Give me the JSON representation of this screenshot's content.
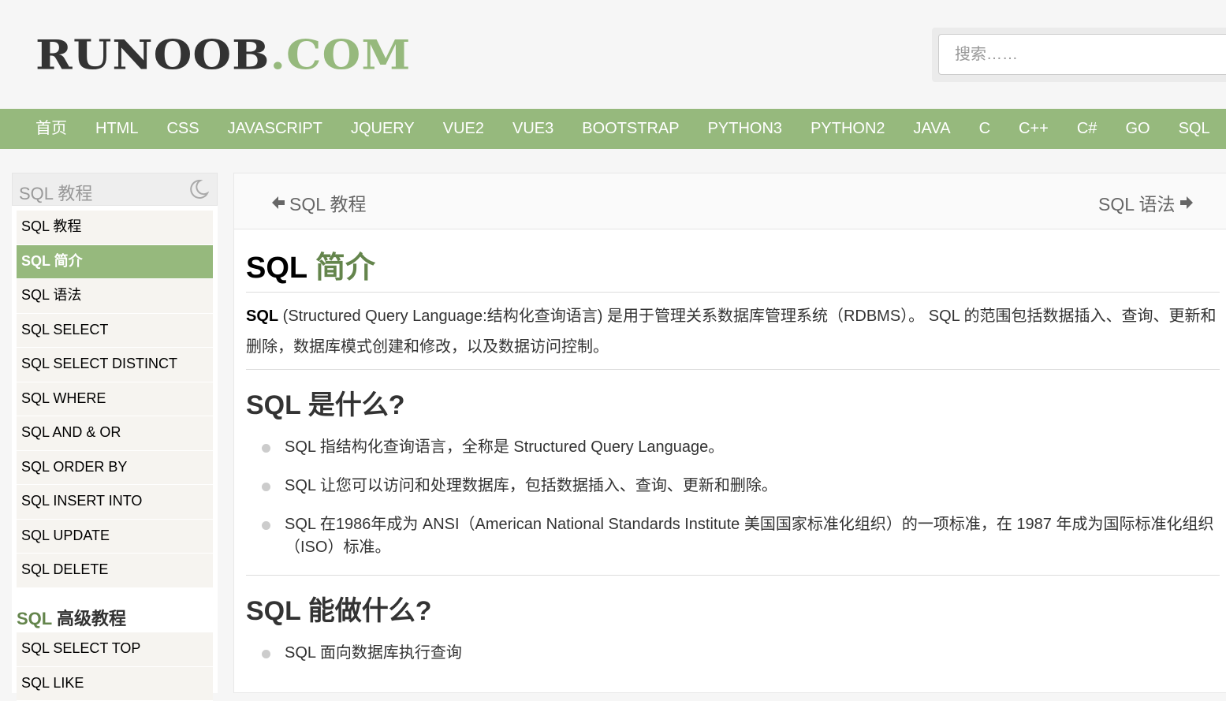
{
  "logo": {
    "dark": "RUNOOB",
    "green": ".COM"
  },
  "search": {
    "placeholder": "搜索……"
  },
  "nav": [
    "首页",
    "HTML",
    "CSS",
    "JAVASCRIPT",
    "JQUERY",
    "VUE2",
    "VUE3",
    "BOOTSTRAP",
    "PYTHON3",
    "PYTHON2",
    "JAVA",
    "C",
    "C++",
    "C#",
    "GO",
    "SQL"
  ],
  "sidebar": {
    "title": "SQL 教程",
    "items": [
      "SQL 教程",
      "SQL 简介",
      "SQL 语法",
      "SQL SELECT",
      "SQL SELECT DISTINCT",
      "SQL WHERE",
      "SQL AND & OR",
      "SQL ORDER BY",
      "SQL INSERT INTO",
      "SQL UPDATE",
      "SQL DELETE"
    ],
    "active_index": 1,
    "section": {
      "prefix": "SQL",
      "rest": " 高级教程"
    },
    "items2": [
      "SQL SELECT TOP",
      "SQL LIKE"
    ]
  },
  "pager": {
    "prev": "SQL 教程",
    "next": "SQL 语法"
  },
  "article": {
    "title_prefix": "SQL ",
    "title_highlight": "简介",
    "intro_bold": "SQL",
    "intro_rest": " (Structured Query Language:结构化查询语言) 是用于管理关系数据库管理系统（RDBMS）。 SQL 的范围包括数据插入、查询、更新和删除，数据库模式创建和修改，以及数据访问控制。",
    "h2_what": "SQL 是什么?",
    "what_items": [
      "SQL 指结构化查询语言，全称是 Structured Query Language。",
      "SQL 让您可以访问和处理数据库，包括数据插入、查询、更新和删除。",
      "SQL 在1986年成为 ANSI（American National Standards Institute 美国国家标准化组织）的一项标准，在 1987 年成为国际标准化组织（ISO）标准。"
    ],
    "h2_can": "SQL 能做什么?",
    "can_items": [
      "SQL 面向数据库执行查询"
    ]
  },
  "colors": {
    "brand_green": "#96b97d",
    "dark_green": "#64854c"
  },
  "icons": {
    "theme_toggle": "moon-icon",
    "prev": "arrow-left-icon",
    "next": "arrow-right-icon"
  }
}
